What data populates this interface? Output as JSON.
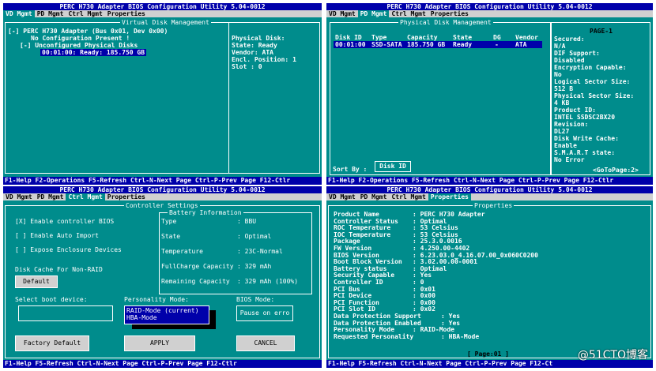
{
  "app_title": "PERC H730 Adapter BIOS Configuration Utility 5.04-0012",
  "menu": [
    "VD Mgmt",
    "PD Mgmt",
    "Ctrl Mgmt",
    "Properties"
  ],
  "status_bar": {
    "q1": "F1-Help F2-Operations F5-Refresh Ctrl-N-Next Page Ctrl-P-Prev Page F12-Ctlr",
    "q2": "F1-Help F2-Operations F5-Refresh Ctrl-N-Next Page Ctrl-P-Prev Page F12-Ctlr",
    "q3": "F1-Help F5-Refresh Ctrl-N-Next Page Ctrl-P-Prev Page F12-Ctlr",
    "q4": "F1-Help F5-Refresh Ctrl-N-Next Page Ctrl-P-Prev Page F12-Ct"
  },
  "vd_mgmt": {
    "frame_title": "Virtual Disk Management",
    "tree": [
      "[-] PERC H730 Adapter (Bus 0x01, Dev 0x00)",
      "No Configuration Present !",
      "[-] Unconfigured Physical Disks",
      "00:01:00: Ready: 185.750 GB"
    ],
    "info": [
      "Physical Disk:",
      "State: Ready",
      "Vendor: ATA",
      "Encl. Position: 1",
      "Slot          : 0"
    ]
  },
  "pd_mgmt": {
    "frame_title": "Physical Disk Management",
    "headers": [
      "Disk ID",
      "Type",
      "Capacity",
      "State",
      "DG",
      "Vendor"
    ],
    "row": [
      "00:01:00",
      "SSD-SATA",
      "185.750 GB",
      "Ready",
      "-",
      "ATA"
    ],
    "sort_label": "Sort By :",
    "sort_value": "Disk ID",
    "page": "PAGE-1",
    "props": [
      "Secured:",
      "N/A",
      "DIF Support:",
      "Disabled",
      "Encryption Capable:",
      "No",
      "Logical Sector Size:",
      "512 B",
      "Physical Sector Size:",
      "4 KB",
      "Product ID:",
      "INTEL SSDSC2BX20",
      "Revision:",
      "DL27",
      "Disk Write Cache:",
      "Enable",
      "S.M.A.R.T state:",
      "No Error"
    ],
    "goto": "<GoToPage:2>"
  },
  "ctrl_mgmt": {
    "frame_title": "Controller Settings",
    "checks": [
      "[X] Enable controller BIOS",
      "[ ] Enable Auto Import",
      "[ ] Expose Enclosure Devices"
    ],
    "battery_title": "Battery Information",
    "battery": [
      [
        "Type",
        ": BBU"
      ],
      [
        "State",
        ": Optimal"
      ],
      [
        "Temperature",
        ": 23C-Normal"
      ],
      [
        "FullCharge Capacity",
        ": 329 mAh"
      ],
      [
        "Remaining Capacity",
        ": 329 mAh (100%)"
      ]
    ],
    "disk_cache_label": "Disk Cache For Non-RAID",
    "default_btn": "Default",
    "boot_label": "Select boot device:",
    "personality_label": "Personality Mode:",
    "personality_options": [
      "RAID-Mode (current)",
      "HBA-Mode"
    ],
    "bios_mode_label": "BIOS Mode:",
    "bios_mode_value": "Pause on erro",
    "factory_btn": "Factory Default",
    "apply_btn": "APPLY",
    "cancel_btn": "CANCEL"
  },
  "properties": {
    "frame_title": "Properties",
    "rows": [
      [
        "Product Name",
        ": PERC H730 Adapter"
      ],
      [
        "Controller Status",
        ": Optimal"
      ],
      [
        "ROC Temperature",
        ": 53 Celsius"
      ],
      [
        "IOC Temperature",
        ": 53 Celsius"
      ],
      [
        "Package",
        ": 25.3.0.0016"
      ],
      [
        "FW Version",
        ": 4.250.00-4402"
      ],
      [
        "BIOS Version",
        ": 6.23.03.0_4.16.07.00_0x060C0200"
      ],
      [
        "Boot Block Version",
        ": 3.02.00.00-0001"
      ],
      [
        "Battery status",
        ": Optimal"
      ],
      [
        "Security Capable",
        ": Yes"
      ],
      [
        "Controller ID",
        ": 0"
      ],
      [
        "PCI Bus",
        ": 0x01"
      ],
      [
        "PCI Device",
        ": 0x00"
      ],
      [
        "PCI Function",
        ": 0x00"
      ],
      [
        "PCI Slot ID",
        ": 0x02"
      ],
      [
        "Data Protection Support",
        ": Yes"
      ],
      [
        "Data Protection Enabled",
        ": Yes"
      ],
      [
        "Personality Mode",
        ": RAID-Mode"
      ],
      [
        "Requested Personality",
        ": HBA-Mode"
      ]
    ],
    "page": "[ Page:01 ]"
  },
  "watermark": "@51CTO博客"
}
